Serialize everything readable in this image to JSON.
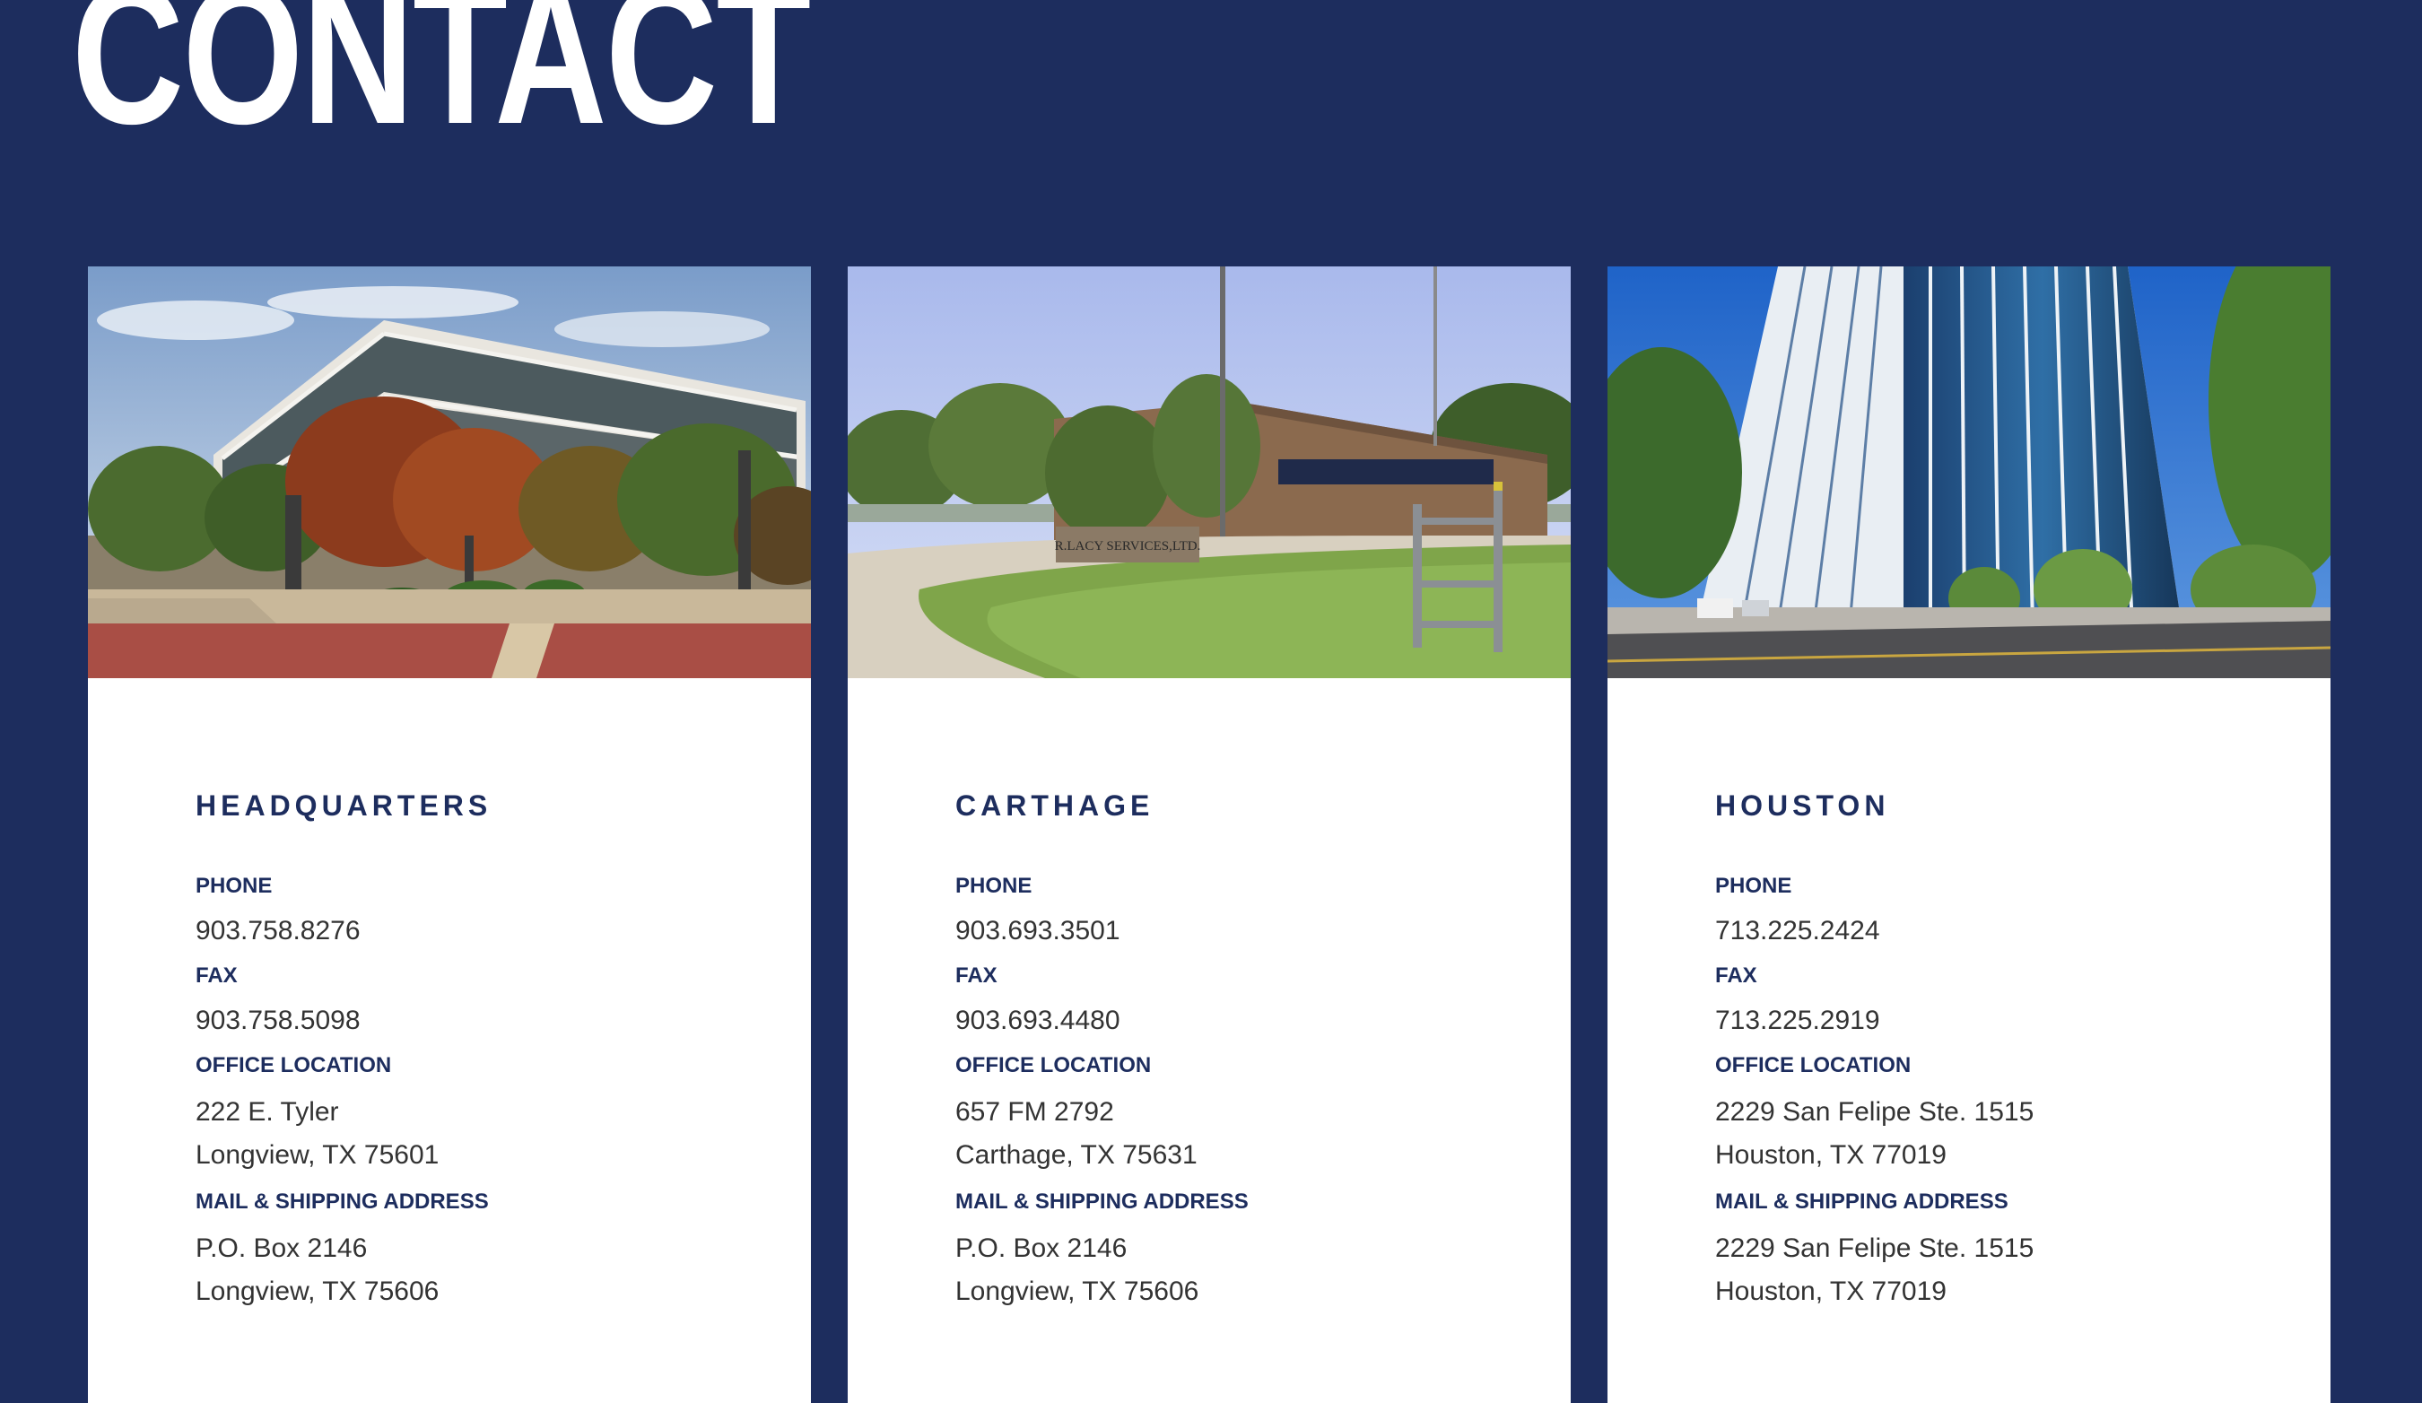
{
  "page": {
    "title": "CONTACT"
  },
  "labels": {
    "phone": "PHONE",
    "fax": "FAX",
    "office_location": "OFFICE LOCATION",
    "mail_shipping": "MAIL & SHIPPING ADDRESS"
  },
  "offices": [
    {
      "name": "HEADQUARTERS",
      "phone": "903.758.8276",
      "fax": "903.758.5098",
      "office_line1": "222 E. Tyler",
      "office_line2": "Longview, TX 75601",
      "mail_line1": "P.O. Box 2146",
      "mail_line2": "Longview, TX 75606"
    },
    {
      "name": "CARTHAGE",
      "phone": "903.693.3501",
      "fax": "903.693.4480",
      "office_line1": "657 FM 2792",
      "office_line2": "Carthage, TX 75631",
      "mail_line1": "P.O. Box 2146",
      "mail_line2": "Longview, TX 75606",
      "sign_text": "R.LACY SERVICES,LTD."
    },
    {
      "name": "HOUSTON",
      "phone": "713.225.2424",
      "fax": "713.225.2919",
      "office_line1": "2229 San Felipe Ste. 1515",
      "office_line2": "Houston, TX 77019",
      "mail_line1": "2229 San Felipe Ste. 1515",
      "mail_line2": "Houston, TX 77019"
    }
  ],
  "colors": {
    "background": "#1d2d5e",
    "card": "#ffffff",
    "heading": "#1d2d5e",
    "body_text": "#333333"
  }
}
